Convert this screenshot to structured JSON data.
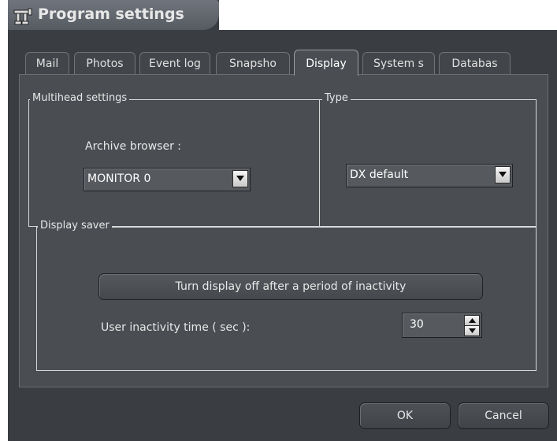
{
  "window": {
    "title": "Program settings"
  },
  "tabs": [
    {
      "label": "Mail"
    },
    {
      "label": "Photos"
    },
    {
      "label": "Event log"
    },
    {
      "label": "Snapsho"
    },
    {
      "label": "Display"
    },
    {
      "label": "System s"
    },
    {
      "label": "Databas"
    }
  ],
  "active_tab": "Display",
  "multihead": {
    "group_label": "Multihead settings",
    "archive_browser_label": "Archive browser :",
    "archive_browser_value": "MONITOR 0"
  },
  "type": {
    "group_label": "Type",
    "value": "DX default"
  },
  "display_saver": {
    "group_label": "Display saver",
    "toggle_label": "Turn display off after a period of inactivity",
    "inactivity_label": "User inactivity time ( sec ):",
    "inactivity_value": "30"
  },
  "footer": {
    "ok_label": "OK",
    "cancel_label": "Cancel"
  },
  "colors": {
    "window_background": "#3a3d42",
    "panel_background": "#4a4d52",
    "text": "#e8e8e8",
    "group_border": "#d8d8d8"
  },
  "icons": {
    "title": "settings-tool-icon",
    "combo_arrow": "chevron-down-icon",
    "spin_up": "triangle-up-icon",
    "spin_down": "triangle-down-icon"
  }
}
